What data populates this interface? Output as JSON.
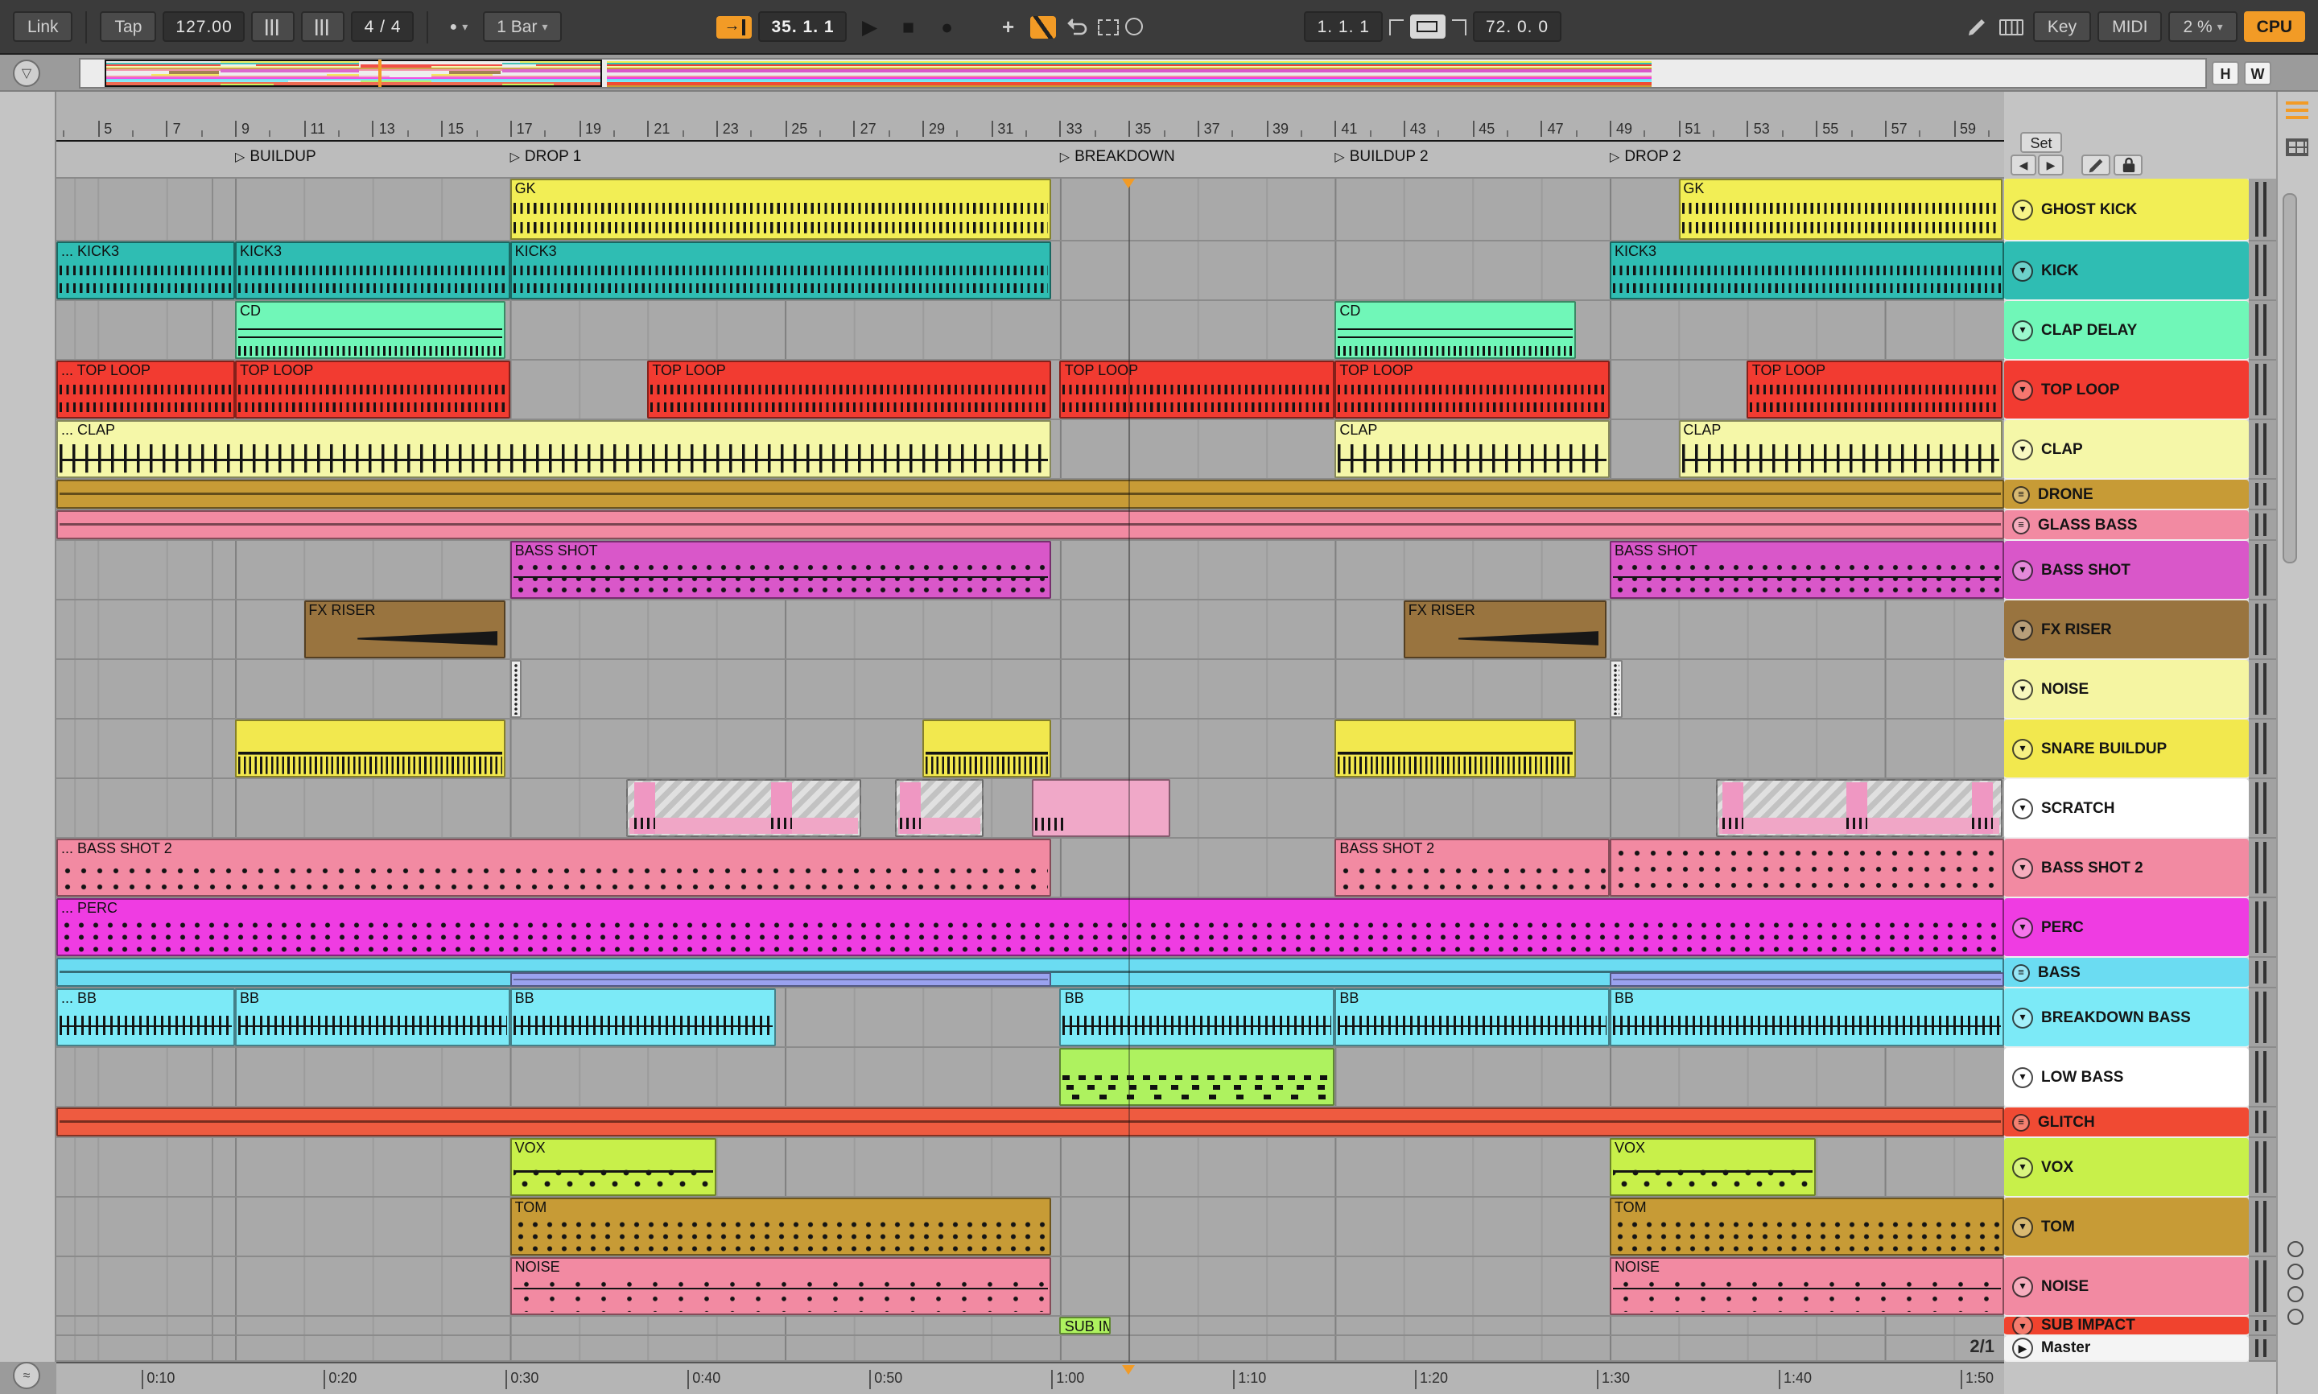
{
  "ui": {
    "accent": "#f29b26",
    "toolbar_bg": "#3b3b3b",
    "lane_bg": "#a9a9a9"
  },
  "transport": {
    "link_label": "Link",
    "tap_label": "Tap",
    "tempo": "127.00",
    "time_signature": "4 / 4",
    "quantization": "1 Bar",
    "position": "35. 1. 1",
    "loop_start": "1. 1. 1",
    "loop_length": "72. 0. 0",
    "key_label": "Key",
    "midi_label": "MIDI",
    "cpu_percent": "2 %",
    "cpu_label": "CPU"
  },
  "overview_bar": {
    "h_label": "H",
    "w_label": "W"
  },
  "arrangement": {
    "set_label": "Set",
    "bar_numbers": [
      5,
      7,
      9,
      11,
      13,
      15,
      17,
      19,
      21,
      23,
      25,
      27,
      29,
      31,
      33,
      35,
      37,
      39,
      41,
      43,
      45,
      47,
      49,
      51,
      53,
      55,
      57,
      59
    ],
    "locators": [
      {
        "name": "BUILDUP",
        "bar": 9
      },
      {
        "name": "DROP 1",
        "bar": 17
      },
      {
        "name": "BREAKDOWN",
        "bar": 33
      },
      {
        "name": "BUILDUP 2",
        "bar": 41
      },
      {
        "name": "DROP 2",
        "bar": 49
      }
    ],
    "playhead_bar": 35,
    "time_labels": [
      "0:10",
      "0:20",
      "0:30",
      "0:40",
      "0:50",
      "1:00",
      "1:10",
      "1:20",
      "1:30",
      "1:40",
      "1:50"
    ]
  },
  "tracks": [
    {
      "name": "GHOST KICK",
      "color": "#f2ee55",
      "size": "first",
      "icon": "fold",
      "clips": [
        {
          "label": "GK",
          "start": 17,
          "end": 32.75,
          "pattern": "ticks2"
        },
        {
          "label": "GK",
          "start": 51,
          "end": 60.45,
          "pattern": "ticks2"
        }
      ]
    },
    {
      "name": "KICK",
      "color": "#2fbdb3",
      "size": "normal",
      "icon": "fold",
      "clips": [
        {
          "label": "... KICK3",
          "start": 3.8,
          "end": 9,
          "pattern": "ticks2"
        },
        {
          "label": "KICK3",
          "start": 9,
          "end": 17,
          "pattern": "ticks2"
        },
        {
          "label": "KICK3",
          "start": 17,
          "end": 32.75,
          "pattern": "ticks2"
        },
        {
          "label": "KICK3",
          "start": 49,
          "end": 60.45,
          "pattern": "ticks2"
        }
      ]
    },
    {
      "name": "CLAP DELAY",
      "color": "#70f7b8",
      "size": "normal",
      "icon": "fold",
      "clips": [
        {
          "label": "CD",
          "start": 9,
          "end": 16.85,
          "pattern": "cdlines"
        },
        {
          "label": "CD",
          "start": 41,
          "end": 48,
          "pattern": "cdlines"
        }
      ]
    },
    {
      "name": "TOP LOOP",
      "color": "#f23b31",
      "size": "normal",
      "icon": "fold",
      "clips": [
        {
          "label": "... TOP LOOP",
          "start": 3.8,
          "end": 9,
          "pattern": "ticks2"
        },
        {
          "label": "TOP LOOP",
          "start": 9,
          "end": 17,
          "pattern": "ticks2"
        },
        {
          "label": "TOP LOOP",
          "start": 21,
          "end": 32.75,
          "pattern": "ticks2"
        },
        {
          "label": "TOP LOOP",
          "start": 33,
          "end": 41,
          "pattern": "ticks2"
        },
        {
          "label": "TOP LOOP",
          "start": 41,
          "end": 49,
          "pattern": "ticks2"
        },
        {
          "label": "TOP LOOP",
          "start": 53,
          "end": 60.45,
          "pattern": "ticks2"
        }
      ]
    },
    {
      "name": "CLAP",
      "color": "#f5f7a8",
      "size": "normal",
      "icon": "fold",
      "clips": [
        {
          "label": "... CLAP",
          "start": 3.8,
          "end": 32.75,
          "pattern": "tallbars"
        },
        {
          "label": "CLAP",
          "start": 41,
          "end": 49,
          "pattern": "tallbars"
        },
        {
          "label": "CLAP",
          "start": 51,
          "end": 60.45,
          "pattern": "tallbars"
        }
      ]
    },
    {
      "name": "DRONE",
      "color": "#c79b36",
      "size": "thin",
      "icon": "lines",
      "clips": [
        {
          "label": "",
          "start": 3.8,
          "end": 60.45,
          "pattern": "strip"
        }
      ]
    },
    {
      "name": "GLASS BASS",
      "color": "#f28aa2",
      "size": "thin",
      "icon": "lines",
      "clips": [
        {
          "label": "",
          "start": 3.8,
          "end": 60.45,
          "pattern": "strip"
        }
      ]
    },
    {
      "name": "BASS SHOT",
      "color": "#d957c9",
      "size": "normal",
      "icon": "fold",
      "clips": [
        {
          "label": "BASS SHOT",
          "start": 17,
          "end": 32.75,
          "pattern": "dotsline"
        },
        {
          "label": "BASS SHOT",
          "start": 49,
          "end": 60.45,
          "pattern": "dotsline"
        }
      ]
    },
    {
      "name": "FX RISER",
      "color": "#99743f",
      "size": "normal",
      "icon": "fold",
      "clips": [
        {
          "label": "FX RISER",
          "start": 11,
          "end": 16.85,
          "pattern": "riser"
        },
        {
          "label": "FX RISER",
          "start": 43,
          "end": 48.9,
          "pattern": "riser"
        }
      ]
    },
    {
      "name": "NOISE",
      "color": "#f5f5a2",
      "size": "normal",
      "icon": "fold",
      "clips": [
        {
          "label": "",
          "start": 17,
          "end": 17.35,
          "color": "#ececec",
          "pattern": "burst"
        },
        {
          "label": "",
          "start": 49,
          "end": 49.35,
          "color": "#ececec",
          "pattern": "burst"
        }
      ]
    },
    {
      "name": "SNARE BUILDUP",
      "color": "#f2e84e",
      "size": "normal",
      "icon": "fold",
      "clips": [
        {
          "label": "",
          "start": 9,
          "end": 16.85,
          "pattern": "snare"
        },
        {
          "label": "",
          "start": 29,
          "end": 32.75,
          "pattern": "snare"
        },
        {
          "label": "",
          "start": 41,
          "end": 48,
          "pattern": "snare"
        }
      ]
    },
    {
      "name": "SCRATCH",
      "color": "#ffffff",
      "size": "normal",
      "icon": "fold",
      "clips": [
        {
          "label": "",
          "start": 20.4,
          "end": 27.2,
          "color": "#d6d6d6",
          "pattern": "hatch",
          "marks": [
            0.02,
            0.62
          ]
        },
        {
          "label": "",
          "start": 28.2,
          "end": 30.8,
          "color": "#d6d6d6",
          "pattern": "hatch",
          "marks": [
            0.03
          ]
        },
        {
          "label": "",
          "start": 32.2,
          "end": 36.2,
          "color": "#f0a8c8",
          "pattern": "scratchpink"
        },
        {
          "label": "",
          "start": 52.1,
          "end": 60.45,
          "color": "#d6d6d6",
          "pattern": "hatch",
          "marks": [
            0.01,
            0.45,
            0.9
          ]
        }
      ]
    },
    {
      "name": "BASS SHOT 2",
      "color": "#f28aa2",
      "size": "normal",
      "icon": "fold",
      "clips": [
        {
          "label": "... BASS SHOT 2",
          "start": 3.8,
          "end": 32.75,
          "pattern": "dots2"
        },
        {
          "label": "BASS SHOT 2",
          "start": 41,
          "end": 49,
          "pattern": "dots2"
        },
        {
          "label": "",
          "start": 49,
          "end": 60.45,
          "pattern": "dots2"
        }
      ]
    },
    {
      "name": "PERC",
      "color": "#ef3ce2",
      "size": "normal",
      "icon": "fold",
      "clips": [
        {
          "label": "... PERC",
          "start": 3.8,
          "end": 60.45,
          "pattern": "dots3"
        }
      ]
    },
    {
      "name": "BASS",
      "color": "#6bdcf2",
      "size": "thin",
      "icon": "lines",
      "clips": [
        {
          "label": "",
          "start": 3.8,
          "end": 60.45,
          "pattern": "strip"
        },
        {
          "label": "",
          "start": 17,
          "end": 32.75,
          "color": "#9aa2ef",
          "pattern": "striplow"
        },
        {
          "label": "",
          "start": 49,
          "end": 60.45,
          "color": "#9aa2ef",
          "pattern": "striplow"
        }
      ]
    },
    {
      "name": "BREAKDOWN BASS",
      "color": "#7ceaf7",
      "size": "normal",
      "icon": "fold",
      "clips": [
        {
          "label": "... BB",
          "start": 3.8,
          "end": 9,
          "pattern": "ticksmid"
        },
        {
          "label": "BB",
          "start": 9,
          "end": 17,
          "pattern": "ticksmid"
        },
        {
          "label": "BB",
          "start": 17,
          "end": 24.75,
          "pattern": "ticksmid"
        },
        {
          "label": "BB",
          "start": 33,
          "end": 41,
          "pattern": "ticksmid"
        },
        {
          "label": "BB",
          "start": 41,
          "end": 49,
          "pattern": "ticksmid"
        },
        {
          "label": "BB",
          "start": 49,
          "end": 60.45,
          "pattern": "ticksmid"
        }
      ]
    },
    {
      "name": "LOW BASS",
      "color": "#ffffff",
      "size": "normal",
      "icon": "fold",
      "clips": [
        {
          "label": "",
          "start": 33,
          "end": 41,
          "color": "#aef25f",
          "pattern": "piano"
        }
      ]
    },
    {
      "name": "GLITCH",
      "color": "#f04a33",
      "size": "thin",
      "icon": "lines",
      "clips": [
        {
          "label": "",
          "start": 3.8,
          "end": 60.45,
          "color": "#ee5b40",
          "pattern": "strip"
        }
      ]
    },
    {
      "name": "VOX",
      "color": "#c8f04a",
      "size": "normal",
      "icon": "fold",
      "clips": [
        {
          "label": "VOX",
          "start": 17,
          "end": 23,
          "pattern": "vox"
        },
        {
          "label": "VOX",
          "start": 49,
          "end": 55,
          "pattern": "vox"
        }
      ]
    },
    {
      "name": "TOM",
      "color": "#c79b36",
      "size": "normal",
      "icon": "fold",
      "clips": [
        {
          "label": "TOM",
          "start": 17,
          "end": 32.75,
          "pattern": "dots3"
        },
        {
          "label": "TOM",
          "start": 49,
          "end": 60.45,
          "pattern": "dots3"
        }
      ]
    },
    {
      "name": "NOISE",
      "color": "#f28aa2",
      "size": "normal",
      "icon": "fold",
      "clips": [
        {
          "label": "NOISE",
          "start": 17,
          "end": 32.75,
          "pattern": "sparse"
        },
        {
          "label": "NOISE",
          "start": 49,
          "end": 60.45,
          "pattern": "sparse"
        }
      ]
    },
    {
      "name": "SUB IMPACT",
      "color": "#f0432e",
      "size": "partial",
      "icon": "fold",
      "clips": [
        {
          "label": "SUB IMPACT",
          "start": 33,
          "end": 34.5,
          "color": "#aef25f"
        }
      ]
    }
  ],
  "master": {
    "name": "Master",
    "grid_label": "2/1"
  }
}
